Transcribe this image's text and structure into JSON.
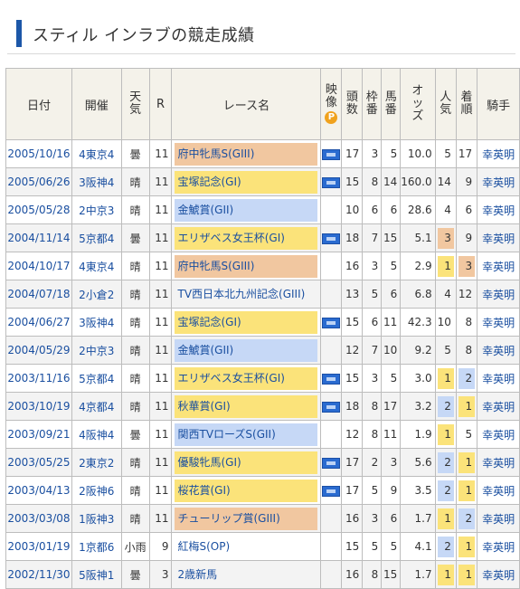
{
  "page_title": "スティル インラブの競走成績",
  "headers": {
    "date": "日付",
    "venue": "開催",
    "weather": "天気",
    "race_no": "R",
    "race_name": "レース名",
    "video": "映像",
    "video_badge": "P",
    "heads": "頭数",
    "waku": "枠番",
    "umaban": "馬番",
    "odds": "オッズ",
    "popularity": "人気",
    "finish": "着順",
    "jockey": "騎手"
  },
  "rows": [
    {
      "date": "2005/10/16",
      "venue": "4東京4",
      "weather": "曇",
      "r": "11",
      "race": "府中牝馬S(GIII)",
      "grade": "g3",
      "video": true,
      "heads": "17",
      "waku": "3",
      "umaban": "5",
      "odds": "10.0",
      "pop": "5",
      "pop_hl": "",
      "finish": "17",
      "finish_hl": "",
      "jockey": "幸英明"
    },
    {
      "date": "2005/06/26",
      "venue": "3阪神4",
      "weather": "晴",
      "r": "11",
      "race": "宝塚記念(GI)",
      "grade": "g1",
      "video": true,
      "heads": "15",
      "waku": "8",
      "umaban": "14",
      "odds": "160.0",
      "pop": "14",
      "pop_hl": "",
      "finish": "9",
      "finish_hl": "",
      "jockey": "幸英明"
    },
    {
      "date": "2005/05/28",
      "venue": "2中京3",
      "weather": "晴",
      "r": "11",
      "race": "金鯱賞(GII)",
      "grade": "g2",
      "video": false,
      "heads": "10",
      "waku": "6",
      "umaban": "6",
      "odds": "28.6",
      "pop": "4",
      "pop_hl": "",
      "finish": "6",
      "finish_hl": "",
      "jockey": "幸英明"
    },
    {
      "date": "2004/11/14",
      "venue": "5京都4",
      "weather": "曇",
      "r": "11",
      "race": "エリザベス女王杯(GI)",
      "grade": "g1",
      "video": true,
      "heads": "18",
      "waku": "7",
      "umaban": "15",
      "odds": "5.1",
      "pop": "3",
      "pop_hl": "o",
      "finish": "9",
      "finish_hl": "",
      "jockey": "幸英明"
    },
    {
      "date": "2004/10/17",
      "venue": "4東京4",
      "weather": "晴",
      "r": "11",
      "race": "府中牝馬S(GIII)",
      "grade": "g3",
      "video": false,
      "heads": "16",
      "waku": "3",
      "umaban": "5",
      "odds": "2.9",
      "pop": "1",
      "pop_hl": "y",
      "finish": "3",
      "finish_hl": "o",
      "jockey": "幸英明"
    },
    {
      "date": "2004/07/18",
      "venue": "2小倉2",
      "weather": "晴",
      "r": "11",
      "race": "TV西日本北九州記念(GIII)",
      "grade": "",
      "video": false,
      "heads": "13",
      "waku": "5",
      "umaban": "6",
      "odds": "6.8",
      "pop": "4",
      "pop_hl": "",
      "finish": "12",
      "finish_hl": "",
      "jockey": "幸英明"
    },
    {
      "date": "2004/06/27",
      "venue": "3阪神4",
      "weather": "晴",
      "r": "11",
      "race": "宝塚記念(GI)",
      "grade": "g1",
      "video": true,
      "heads": "15",
      "waku": "6",
      "umaban": "11",
      "odds": "42.3",
      "pop": "10",
      "pop_hl": "",
      "finish": "8",
      "finish_hl": "",
      "jockey": "幸英明"
    },
    {
      "date": "2004/05/29",
      "venue": "2中京3",
      "weather": "晴",
      "r": "11",
      "race": "金鯱賞(GII)",
      "grade": "g2",
      "video": false,
      "heads": "12",
      "waku": "7",
      "umaban": "10",
      "odds": "9.2",
      "pop": "5",
      "pop_hl": "",
      "finish": "8",
      "finish_hl": "",
      "jockey": "幸英明"
    },
    {
      "date": "2003/11/16",
      "venue": "5京都4",
      "weather": "晴",
      "r": "11",
      "race": "エリザベス女王杯(GI)",
      "grade": "g1",
      "video": true,
      "heads": "15",
      "waku": "3",
      "umaban": "5",
      "odds": "3.0",
      "pop": "1",
      "pop_hl": "y",
      "finish": "2",
      "finish_hl": "b",
      "jockey": "幸英明"
    },
    {
      "date": "2003/10/19",
      "venue": "4京都4",
      "weather": "晴",
      "r": "11",
      "race": "秋華賞(GI)",
      "grade": "g1",
      "video": true,
      "heads": "18",
      "waku": "8",
      "umaban": "17",
      "odds": "3.2",
      "pop": "2",
      "pop_hl": "b",
      "finish": "1",
      "finish_hl": "y",
      "jockey": "幸英明"
    },
    {
      "date": "2003/09/21",
      "venue": "4阪神4",
      "weather": "曇",
      "r": "11",
      "race": "関西TVローズS(GII)",
      "grade": "g2",
      "video": false,
      "heads": "12",
      "waku": "8",
      "umaban": "11",
      "odds": "1.9",
      "pop": "1",
      "pop_hl": "y",
      "finish": "5",
      "finish_hl": "",
      "jockey": "幸英明"
    },
    {
      "date": "2003/05/25",
      "venue": "2東京2",
      "weather": "晴",
      "r": "11",
      "race": "優駿牝馬(GI)",
      "grade": "g1",
      "video": true,
      "heads": "17",
      "waku": "2",
      "umaban": "3",
      "odds": "5.6",
      "pop": "2",
      "pop_hl": "b",
      "finish": "1",
      "finish_hl": "y",
      "jockey": "幸英明"
    },
    {
      "date": "2003/04/13",
      "venue": "2阪神6",
      "weather": "晴",
      "r": "11",
      "race": "桜花賞(GI)",
      "grade": "g1",
      "video": true,
      "heads": "17",
      "waku": "5",
      "umaban": "9",
      "odds": "3.5",
      "pop": "2",
      "pop_hl": "b",
      "finish": "1",
      "finish_hl": "y",
      "jockey": "幸英明"
    },
    {
      "date": "2003/03/08",
      "venue": "1阪神3",
      "weather": "晴",
      "r": "11",
      "race": "チューリップ賞(GIII)",
      "grade": "g3",
      "video": false,
      "heads": "16",
      "waku": "3",
      "umaban": "6",
      "odds": "1.7",
      "pop": "1",
      "pop_hl": "y",
      "finish": "2",
      "finish_hl": "b",
      "jockey": "幸英明"
    },
    {
      "date": "2003/01/19",
      "venue": "1京都6",
      "weather": "小雨",
      "r": "9",
      "race": "紅梅S(OP)",
      "grade": "",
      "video": false,
      "heads": "15",
      "waku": "5",
      "umaban": "5",
      "odds": "4.1",
      "pop": "2",
      "pop_hl": "b",
      "finish": "1",
      "finish_hl": "y",
      "jockey": "幸英明"
    },
    {
      "date": "2002/11/30",
      "venue": "5阪神1",
      "weather": "曇",
      "r": "3",
      "race": "2歳新馬",
      "grade": "",
      "video": false,
      "heads": "16",
      "waku": "8",
      "umaban": "15",
      "odds": "1.7",
      "pop": "1",
      "pop_hl": "y",
      "finish": "1",
      "finish_hl": "y",
      "jockey": "幸英明"
    }
  ]
}
